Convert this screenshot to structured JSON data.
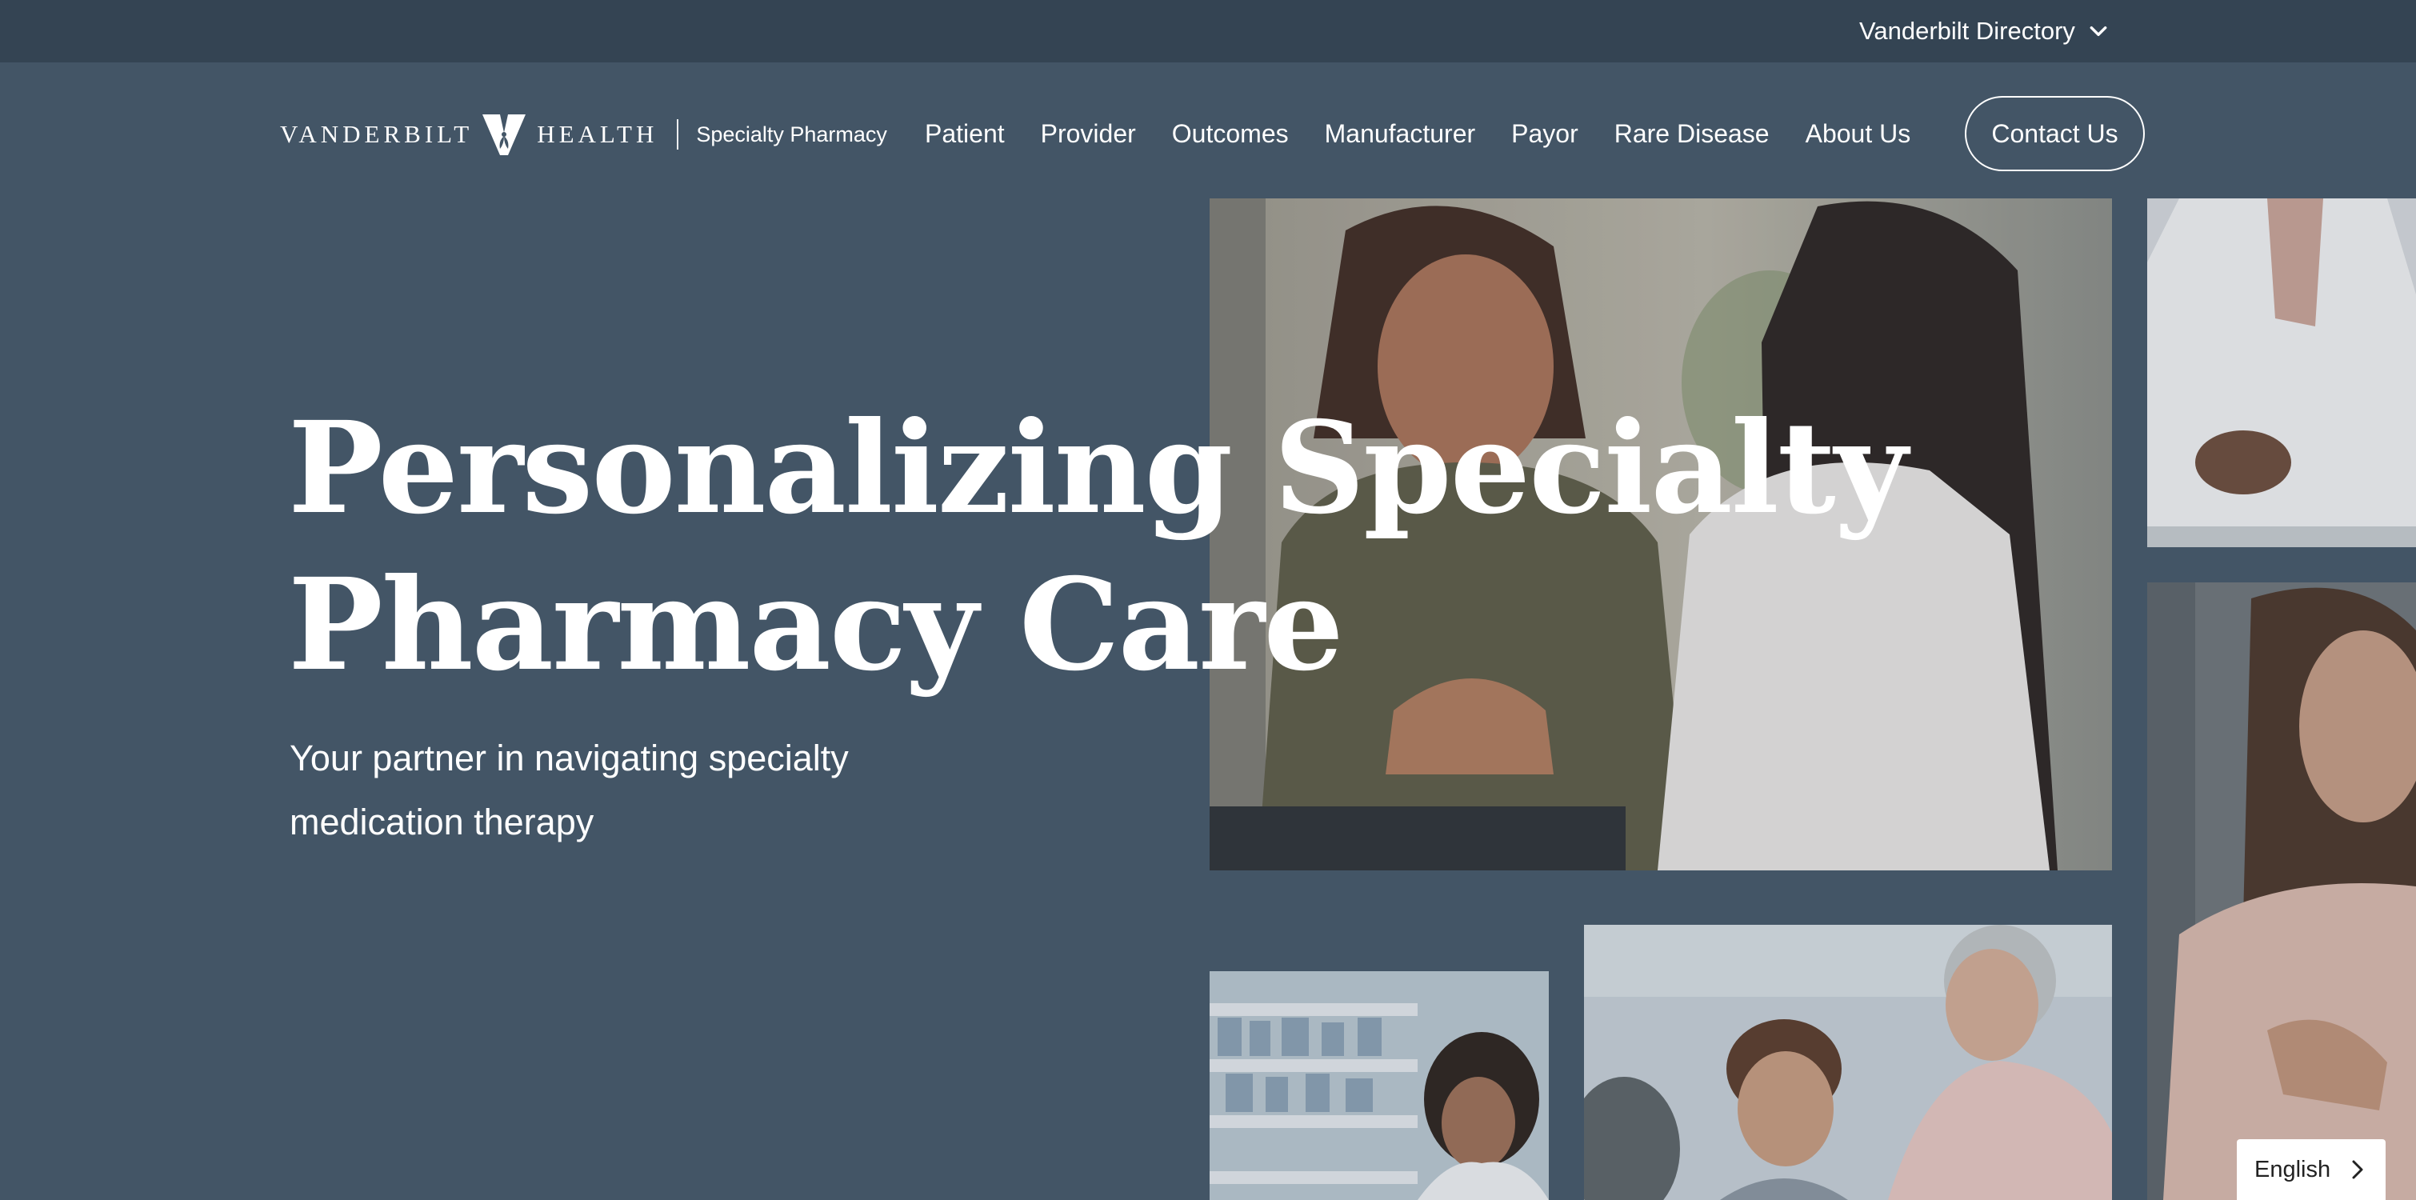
{
  "topbar": {
    "directory_label": "Vanderbilt Directory",
    "directory_icon": "chevron-down-icon"
  },
  "header": {
    "logo": {
      "wordmark_left": "VANDERBILT",
      "wordmark_right": "HEALTH",
      "subtitle": "Specialty Pharmacy"
    },
    "nav_items": [
      {
        "label": "Patient"
      },
      {
        "label": "Provider"
      },
      {
        "label": "Outcomes"
      },
      {
        "label": "Manufacturer"
      },
      {
        "label": "Payor"
      },
      {
        "label": "Rare Disease"
      },
      {
        "label": "About Us"
      }
    ],
    "contact_label": "Contact Us"
  },
  "hero": {
    "title_line1": "Personalizing Specialty",
    "title_line2": "Pharmacy Care",
    "subtitle_line1": "Your partner in navigating specialty",
    "subtitle_line2": "medication therapy"
  },
  "language": {
    "label": "English",
    "icon": "chevron-right-icon"
  },
  "colors": {
    "background": "#435566",
    "topbar": "#344453",
    "text": "#ffffff"
  }
}
